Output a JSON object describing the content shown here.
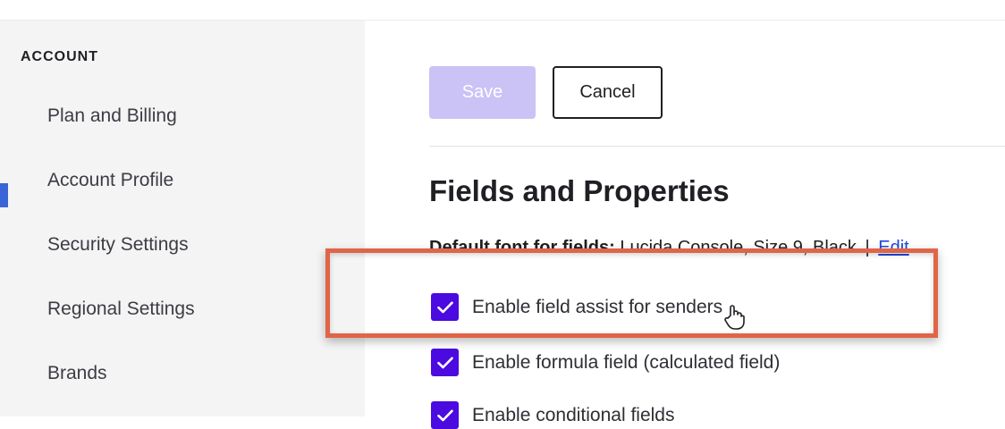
{
  "sidebar": {
    "section_title": "ACCOUNT",
    "items": [
      {
        "label": "Plan and Billing"
      },
      {
        "label": "Account Profile"
      },
      {
        "label": "Security Settings"
      },
      {
        "label": "Regional Settings"
      },
      {
        "label": "Brands"
      }
    ]
  },
  "toolbar": {
    "save_label": "Save",
    "cancel_label": "Cancel"
  },
  "main": {
    "heading": "Fields and Properties",
    "default_font_label": "Default font for fields:",
    "default_font_value": "Lucida Console, Size 9, Black",
    "default_font_separator": "|",
    "edit_label": "Edit",
    "options": [
      {
        "label": "Enable field assist for senders",
        "checked": true
      },
      {
        "label": "Enable formula field (calculated field)",
        "checked": true
      },
      {
        "label": "Enable conditional fields",
        "checked": true
      }
    ]
  },
  "colors": {
    "accent": "#4b0ae0",
    "save_disabled": "#cbc2f6",
    "highlight_border": "#e06548",
    "link": "#1e48d8",
    "sidebar_bg": "#f4f4f4"
  },
  "icons": {
    "checkbox": "check-icon",
    "cursor": "hand-pointer-icon"
  }
}
